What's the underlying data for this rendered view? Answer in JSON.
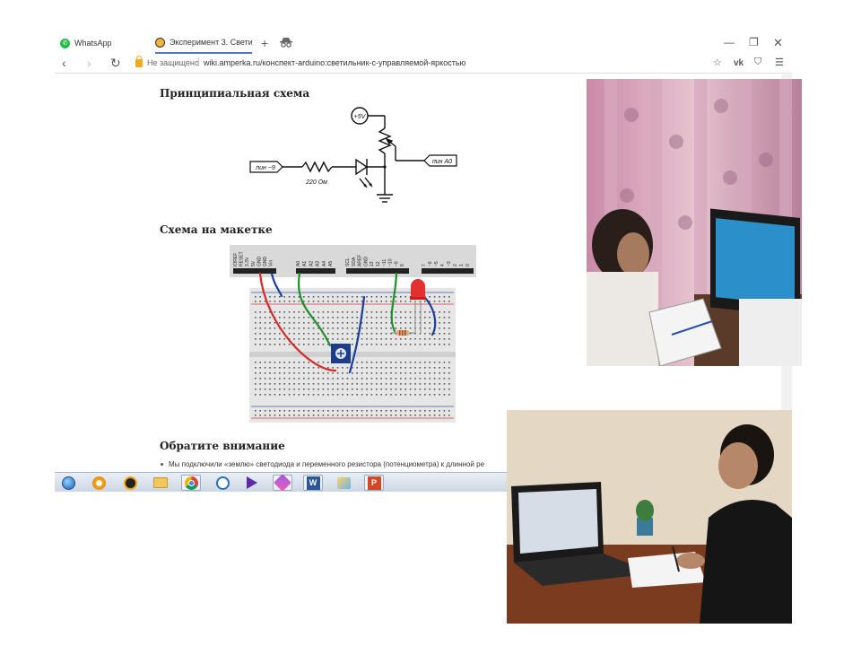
{
  "browser": {
    "tabs": [
      {
        "label": "WhatsApp",
        "icon": "whatsapp-icon"
      },
      {
        "label": "Эксперимент 3. Свети",
        "icon": "amperka-icon"
      }
    ],
    "new_tab_label": "+",
    "address": {
      "security_label": "Не защищено",
      "url": "wiki.amperka.ru/конспект-arduino:светильник-с-управляемой-яркостью"
    }
  },
  "page": {
    "headings": {
      "schematic": "Принципиальная схема",
      "breadboard": "Схема на макетке",
      "note": "Обратите внимание"
    },
    "note_text": "Мы подключили «землю» светодиода и переменного резистора (потенциометра) к длинной ре"
  },
  "schematic": {
    "supply_label": "+5V",
    "input_label": "пин ~9",
    "output_label": "пин A0",
    "resistor_label": "220 Ом"
  },
  "breadboard": {
    "header_left_pins": [
      "IOREF",
      "RESET",
      "3.3V",
      "5V",
      "GND",
      "GND",
      "Vin"
    ],
    "header_analog_pins": [
      "A0",
      "A1",
      "A2",
      "A3",
      "A4",
      "A5"
    ],
    "header_right_pins": [
      "SCL",
      "SDA",
      "AREF",
      "GND",
      "13",
      "12",
      "~11",
      "~10",
      "~9",
      "8"
    ],
    "header_far_pins": [
      "7",
      "~6",
      "~5",
      "4",
      "~3",
      "2",
      "1",
      "0"
    ]
  },
  "taskbar": {
    "apps": [
      "windows-start-icon",
      "opera-icon",
      "avast-icon",
      "folder-icon",
      "chrome-icon",
      "podcast-icon",
      "media-player-icon",
      "onenote-icon",
      "word-icon",
      "paint-icon",
      "powerpoint-icon"
    ]
  },
  "colors": {
    "accent": "#4b78c8",
    "wire_red": "#d42a2a",
    "wire_green": "#1f8f2a",
    "wire_blue": "#1a3f9a"
  }
}
